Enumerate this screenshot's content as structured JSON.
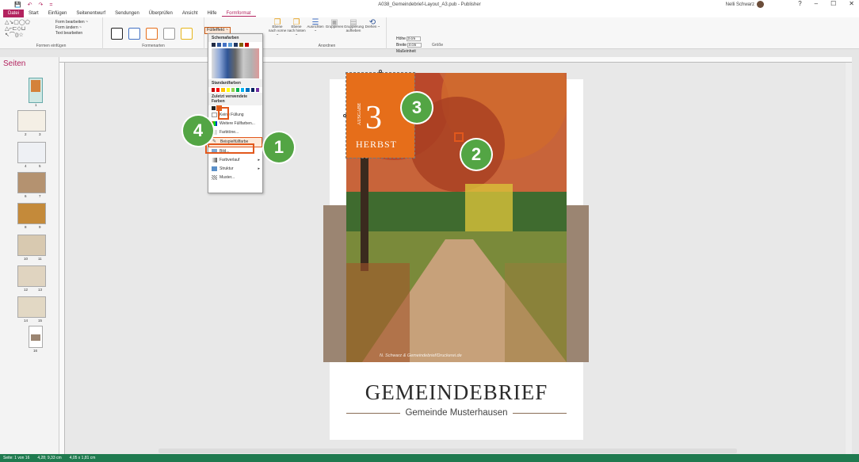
{
  "window": {
    "title": "A038_Gemeindebrief-Layout_A3.pub - Publisher",
    "user_name": "Nelli Schwarz",
    "controls": [
      "?",
      "–",
      "☐",
      "✕"
    ]
  },
  "quick_access": [
    "💾",
    "↶",
    "↷",
    "="
  ],
  "tabs": [
    "Datei",
    "Start",
    "Einfügen",
    "Seitenentwurf",
    "Sendungen",
    "Überprüfen",
    "Ansicht",
    "Hilfe",
    "Formformat"
  ],
  "ribbon": {
    "insert_shapes": {
      "label": "Formen einfügen",
      "edit_shape": "Form bearbeiten ~",
      "change_shape": "Form ändern ~",
      "edit_text": "Text bearbeiten"
    },
    "shape_styles": {
      "label": "Formenarten"
    },
    "fill_button": "Fülleffekt ~",
    "arrange": {
      "label": "Anordnen",
      "items": [
        "Ebene nach vorne ~",
        "Ebene nach hinten ~",
        "Ausrichten ~",
        "Gruppieren",
        "Gruppierung aufheben",
        "Drehen ~"
      ]
    },
    "size": {
      "label": "Größe",
      "height_label": "Höhe",
      "height_value": "3 cm",
      "width_label": "Breite",
      "width_value": "4 cm",
      "measure_label": "Maßeinheit"
    }
  },
  "pages_pane": {
    "title": "Seiten",
    "page_numbers": [
      "1",
      "2",
      "3",
      "4",
      "5",
      "6",
      "7",
      "8",
      "9",
      "10",
      "11",
      "12",
      "13",
      "14",
      "15",
      "16"
    ]
  },
  "fill_dropdown": {
    "scheme_header": "Schemafarben",
    "standard_header": "Standardfarben",
    "recent_header": "Zuletzt verwendete Farben",
    "items": [
      "Keine Füllung",
      "Weitere Füllfarben...",
      "Farbtöne...",
      "Beispielfüllfarbe",
      "Bild...",
      "Farbverlauf",
      "Struktur",
      "Muster..."
    ],
    "highlight_color": "#fde9d9",
    "scheme_colors": [
      "#1f2a44",
      "#2f5597",
      "#4472c4",
      "#5b9bd5",
      "#203864",
      "#7f6000",
      "#c00000"
    ],
    "standard_colors": [
      "#c00000",
      "#ff0000",
      "#ffc000",
      "#ffff00",
      "#92d050",
      "#00b050",
      "#00b0f0",
      "#0070c0",
      "#002060",
      "#7030a0"
    ]
  },
  "document": {
    "issue_label": "AUSGABE",
    "issue_number": "3",
    "season": "HERBST",
    "photo_credit": "N. Schwarz & Gemeindebrief/Druckerei.de",
    "title": "GEMEINDEBRIEF",
    "subtitle": "Gemeinde Musterhausen",
    "accent_color": "#e66e1a",
    "band_color": "#9b8572"
  },
  "callouts": [
    "1",
    "2",
    "3",
    "4"
  ],
  "status": {
    "page": "Seite: 1 von 16",
    "position": "4,28; 9,33 cm",
    "size": "4,05 x 1,81 cm"
  }
}
